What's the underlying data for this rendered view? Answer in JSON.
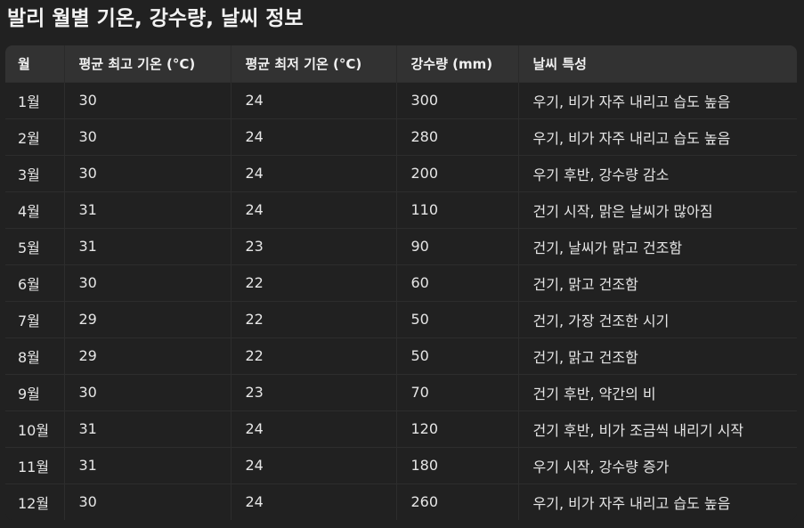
{
  "title": "발리 월별 기온, 강수량, 날씨 정보",
  "table": {
    "headers": [
      "월",
      "평균 최고 기온 (°C)",
      "평균 최저 기온 (°C)",
      "강수량 (mm)",
      "날씨 특성"
    ],
    "rows": [
      [
        "1월",
        "30",
        "24",
        "300",
        "우기, 비가 자주 내리고 습도 높음"
      ],
      [
        "2월",
        "30",
        "24",
        "280",
        "우기, 비가 자주 내리고 습도 높음"
      ],
      [
        "3월",
        "30",
        "24",
        "200",
        "우기 후반, 강수량 감소"
      ],
      [
        "4월",
        "31",
        "24",
        "110",
        "건기 시작, 맑은 날씨가 많아짐"
      ],
      [
        "5월",
        "31",
        "23",
        "90",
        "건기, 날씨가 맑고 건조함"
      ],
      [
        "6월",
        "30",
        "22",
        "60",
        "건기, 맑고 건조함"
      ],
      [
        "7월",
        "29",
        "22",
        "50",
        "건기, 가장 건조한 시기"
      ],
      [
        "8월",
        "29",
        "22",
        "50",
        "건기, 맑고 건조함"
      ],
      [
        "9월",
        "30",
        "23",
        "70",
        "건기 후반, 약간의 비"
      ],
      [
        "10월",
        "31",
        "24",
        "120",
        "건기 후반, 비가 조금씩 내리기 시작"
      ],
      [
        "11월",
        "31",
        "24",
        "180",
        "우기 시작, 강수량 증가"
      ],
      [
        "12월",
        "30",
        "24",
        "260",
        "우기, 비가 자주 내리고 습도 높음"
      ]
    ]
  }
}
